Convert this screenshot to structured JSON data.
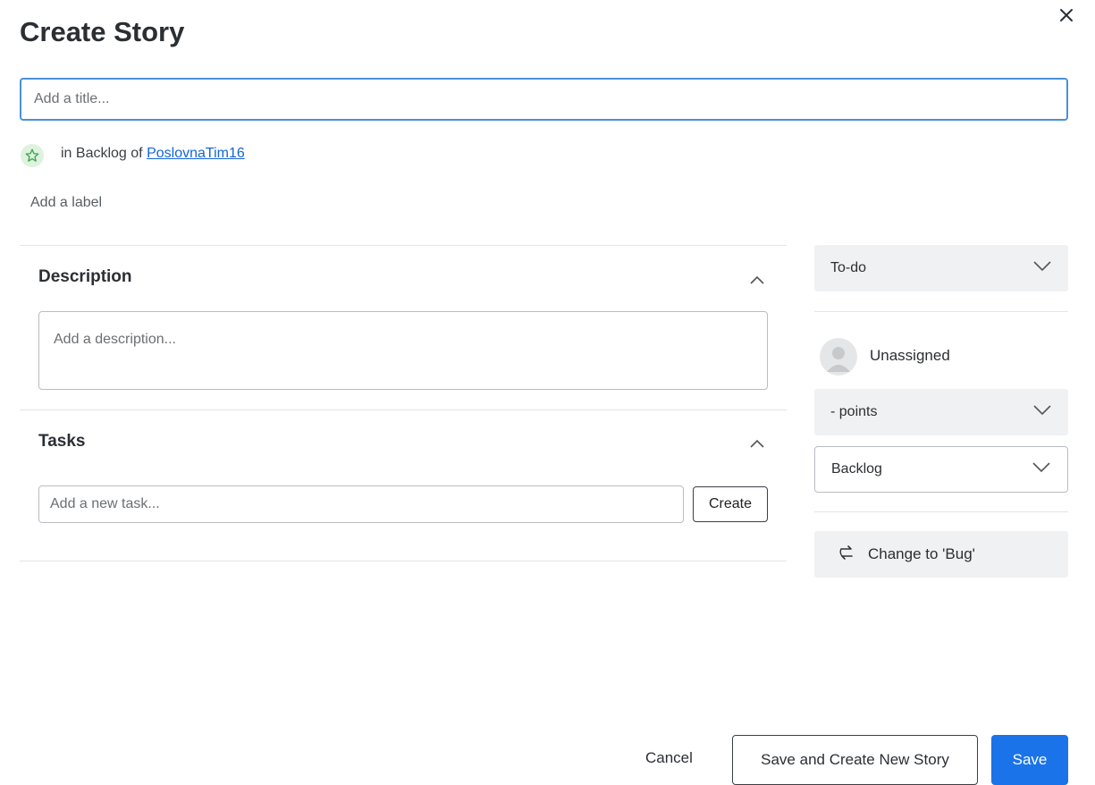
{
  "dialog": {
    "title": "Create Story",
    "close_icon": "close-icon"
  },
  "title_input": {
    "placeholder": "Add a title...",
    "value": ""
  },
  "location": {
    "icon": "star-icon",
    "prefix": "in Backlog of",
    "project_link": "PoslovnaTim16"
  },
  "add_label": "Add a label",
  "description": {
    "heading": "Description",
    "placeholder": "Add a description..."
  },
  "tasks": {
    "heading": "Tasks",
    "input_placeholder": "Add a new task...",
    "create_label": "Create"
  },
  "sidebar": {
    "status": "To-do",
    "assignee": "Unassigned",
    "points": "- points",
    "sprint": "Backlog",
    "change_type": "Change to 'Bug'"
  },
  "footer": {
    "cancel": "Cancel",
    "save_and_new": "Save and Create New Story",
    "save": "Save"
  },
  "colors": {
    "accent": "#1a73e8",
    "link": "#1565d8",
    "star_badge_bg": "#dff2df",
    "star": "#3aa84a"
  }
}
